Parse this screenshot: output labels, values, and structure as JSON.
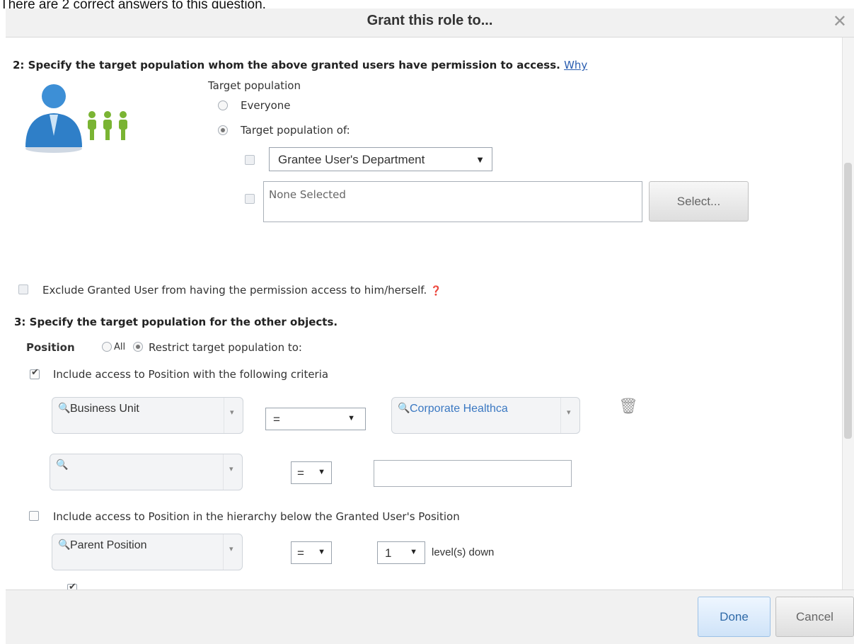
{
  "top_note": "There are 2 correct answers to this question.",
  "dialog": {
    "title": "Grant this role to...",
    "close_icon": "close-icon"
  },
  "section2": {
    "heading": "2: Specify the target population whom the above granted users have permission to access.",
    "why_link": "Why",
    "target_population_label": "Target population",
    "everyone_label": "Everyone",
    "target_population_of_label": "Target population of:",
    "target_population_selected": "Target population of:",
    "department_select": "Grantee User's Department",
    "none_selected": "None Selected",
    "select_button": "Select...",
    "exclude_label": "Exclude Granted User from having the permission access to him/herself."
  },
  "section3": {
    "heading": "3: Specify the target population for the other objects.",
    "position_label": "Position",
    "all_label": "All",
    "restrict_label": "Restrict target population to:",
    "restrict_selected": true,
    "include_criteria_label": "Include access to Position with the following criteria",
    "include_criteria_checked": true,
    "criteria_rows": [
      {
        "field": "Business Unit",
        "operator": "=",
        "value": "Corporate Healthca"
      },
      {
        "field": "",
        "operator": "=",
        "value": ""
      }
    ],
    "include_hierarchy_label": "Include access to Position in the hierarchy below the Granted User's Position",
    "include_hierarchy_checked": false,
    "hierarchy_field": "Parent Position",
    "hierarchy_operator": "=",
    "levels_value": "1",
    "levels_label": "level(s) down"
  },
  "footer": {
    "done_label": "Done",
    "cancel_label": "Cancel"
  },
  "colors": {
    "link": "#2a5db0",
    "corporate_value_text": "#3a78c2",
    "header_bg": "#f1f1f1"
  }
}
